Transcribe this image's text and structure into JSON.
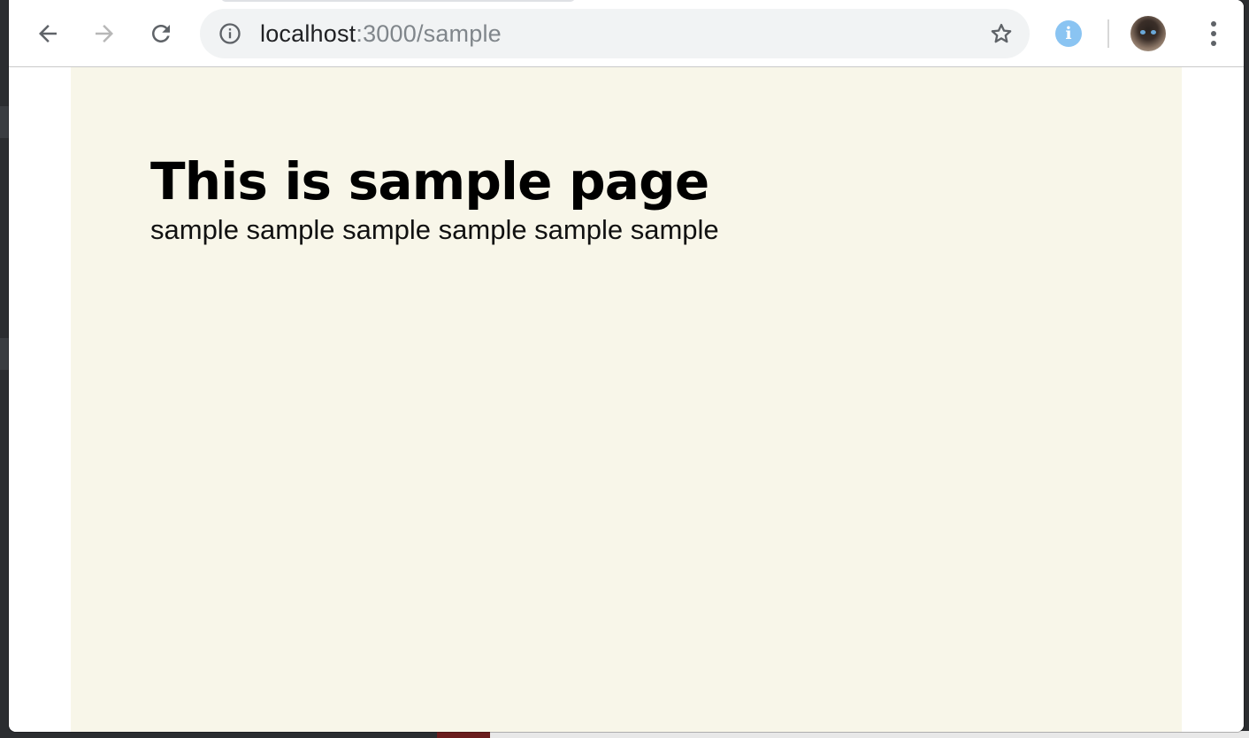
{
  "browser": {
    "url_host": "localhost",
    "url_path": ":3000/sample",
    "extension_label": "i",
    "icons": {
      "back": "arrow-left-icon",
      "forward": "arrow-right-icon",
      "reload": "reload-icon",
      "site_info": "info-circle-icon",
      "bookmark": "star-outline-icon",
      "extension": "info-badge-icon",
      "profile": "avatar",
      "menu": "three-dots-vertical-icon"
    },
    "colors": {
      "toolbar": "#ffffff",
      "omnibox": "#f1f3f4",
      "extension_badge": "#8ac4f2",
      "forward_disabled": "#b7b7b7"
    }
  },
  "page": {
    "title": "This is sample page",
    "text": "sample sample sample sample sample sample",
    "background": "#f8f6e9"
  }
}
